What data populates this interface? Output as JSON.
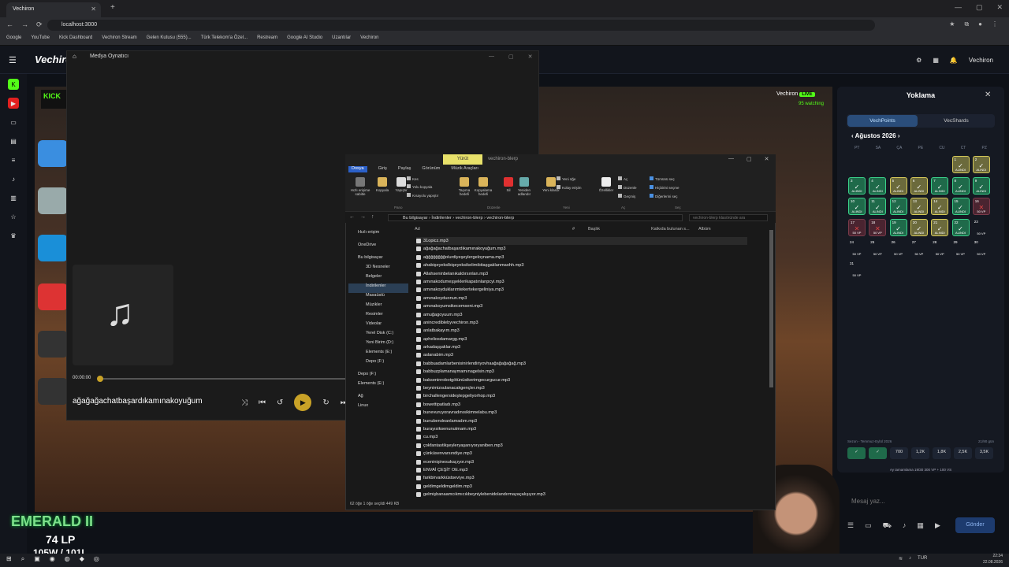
{
  "browser": {
    "tab_title": "Vechiron",
    "url": "localhost:3000",
    "bookmarks": [
      "Google",
      "YouTube",
      "Kick Dashboard",
      "Vechiron Stream",
      "Gelen Kutusu (555)...",
      "Türk Telekom'a Özel...",
      "Restream",
      "Google AI Studio",
      "Uzantılar",
      "Vechiron"
    ]
  },
  "app": {
    "brand": "Vechiron",
    "user": "Vechiron",
    "notif_count": "1"
  },
  "stream": {
    "live_user": "Vechiron",
    "live_label": "LIVE",
    "watching": "95 watching",
    "kick_label": "KICK",
    "rank": "EMERALD II",
    "lp": "74 LP",
    "winloss": "105W / 101L"
  },
  "media_player": {
    "title": "Medya Oynatıcı",
    "time": "00:00:00",
    "song": "ağağağachatbaşardıkamınakoyuğum"
  },
  "explorer": {
    "manage_tab": "Yürüt",
    "window_title": "vechiron-blerp",
    "menus": [
      "Dosya",
      "Giriş",
      "Paylaş",
      "Görünüm",
      "Müzik Araçları"
    ],
    "ribbon": [
      "Hızlı erişime sabitle",
      "Kopyala",
      "Yapıştır",
      "Kes",
      "Yolu kopyala",
      "Kısayolu yapıştır",
      "Taşıma hedefi",
      "Kopyalama hedefi",
      "Sil",
      "Yeniden adlandır",
      "Yeni klasör",
      "Yeni öğe",
      "Kolay erişim",
      "Özellikler",
      "Aç",
      "Düzenle",
      "Geçmiş",
      "Tümünü seç",
      "Hiçbirini seçme",
      "Diğerlerini seç"
    ],
    "ribbon_groups": [
      "Pano",
      "Düzenle",
      "Yeni",
      "Aç",
      "Seç"
    ],
    "path": [
      "Bu bilgisayar",
      "İndirilenler",
      "vechiron-blerp",
      "vechiron-blerp"
    ],
    "search_placeholder": "vechiron-blerp klasöründe ara",
    "columns": [
      "Ad",
      "#",
      "Başlık",
      "Katkıda bulunan s...",
      "Albüm"
    ],
    "sidebar": [
      "Hızlı erişim",
      "OneDrive",
      "Bu bilgisayar",
      "3D Nesneler",
      "Belgeler",
      "İndirilenler",
      "Masaüstü",
      "Müzikler",
      "Resimler",
      "Videolar",
      "Yerel Disk (C:)",
      "Yeni Birim (D:)",
      "Elements (E:)",
      "Depo (F:)",
      "Depo (F:)",
      "Elements (E:)",
      "Ağ",
      "Linux"
    ],
    "files": [
      "31opicz.mp3",
      "ağağağachatbaşardıkamınakoyuğum.mp3",
      "ağğğğğğğğolurdiyeşeylergeloynama.mp3",
      "ahabişeyekslbişeyeksikelimibitaşgaklanmaohh.mp3",
      "Allahseninbelanıkaldırsınlan.mp3",
      "amınakodumeşşeklerikapatınlanpcyi.mp3",
      "amınakoyduklarımtekertekergeliniya.mp3",
      "amınakoyduonun.mp3",
      "amınakoyumsikecemseni.mp3",
      "amuğagoyuum.mp3",
      "anincrediblebyvechiron.mp3",
      "anlatbakayım.mp3",
      "apheliosdamargg.mp3",
      "arkadaşşaklar.mp3",
      "aslanabim.mp3",
      "babbuadamlarbenisinirlendiriyovhaağağağağağ.mp3",
      "babbuzplamanaymamınagelsin.mp3",
      "bakseninrobotgötünüsikerimgecurgucur.mp3",
      "beynimizsulanacakgençler.mp3",
      "birchallengersideştepgeliyorhop.mp3",
      "bowettipatladı.mp3",
      "bunevuruyoravradınısikimnelabu.mp3",
      "bunubendeanlamadım.mp3",
      "burayısiksenunutmam.mp3",
      "cu.mp3",
      "çokfantastikşeyleryaşanıyoryaniben.mp3",
      "çünküsenvarsındiye.mp3",
      "eceninişinesukaçıyor.mp3",
      "ENVAİ ÇEŞİT OE.mp3",
      "farkbirvarkküstseviye.mp3",
      "geldimgeldimgeldim.mp3",
      "gelmişbanaamcıkmıcıkbeyniylebenidolandırmayaçalışıyor.mp3"
    ],
    "status": "62 öğe   1 öğe seçildi  449 KB"
  },
  "attendance": {
    "title": "Yoklama",
    "tab_active": "VechPoints",
    "tab_other": "VecShards",
    "month": "Ağustos 2026",
    "dow": [
      "PT",
      "SA",
      "ÇA",
      "PE",
      "CU",
      "CT",
      "PZ"
    ],
    "claimed": "ALINDI",
    "reward": "50 VP",
    "days": [
      {
        "n": "",
        "s": "e"
      },
      {
        "n": "",
        "s": "e"
      },
      {
        "n": "",
        "s": "e"
      },
      {
        "n": "",
        "s": "e"
      },
      {
        "n": "",
        "s": "e"
      },
      {
        "n": "1",
        "s": "y"
      },
      {
        "n": "2",
        "s": "y"
      },
      {
        "n": "3",
        "s": "g"
      },
      {
        "n": "4",
        "s": "g"
      },
      {
        "n": "5",
        "s": "y"
      },
      {
        "n": "6",
        "s": "y"
      },
      {
        "n": "7",
        "s": "g"
      },
      {
        "n": "8",
        "s": "g"
      },
      {
        "n": "9",
        "s": "g"
      },
      {
        "n": "10",
        "s": "g"
      },
      {
        "n": "11",
        "s": "g"
      },
      {
        "n": "12",
        "s": "g"
      },
      {
        "n": "13",
        "s": "y"
      },
      {
        "n": "14",
        "s": "y"
      },
      {
        "n": "15",
        "s": "g"
      },
      {
        "n": "16",
        "s": "r"
      },
      {
        "n": "17",
        "s": "r"
      },
      {
        "n": "18",
        "s": "r"
      },
      {
        "n": "19",
        "s": "g"
      },
      {
        "n": "20",
        "s": "y"
      },
      {
        "n": "21",
        "s": "y"
      },
      {
        "n": "22",
        "s": "g"
      },
      {
        "n": "23",
        "s": "e"
      },
      {
        "n": "24",
        "s": "e"
      },
      {
        "n": "25",
        "s": "e"
      },
      {
        "n": "26",
        "s": "e"
      },
      {
        "n": "27",
        "s": "e"
      },
      {
        "n": "28",
        "s": "e"
      },
      {
        "n": "29",
        "s": "e"
      },
      {
        "n": "30",
        "s": "e"
      },
      {
        "n": "31",
        "s": "e"
      }
    ],
    "season": "Sezon - Temmuz-Eylül 2026",
    "season_progress": "21/90 gün",
    "stats": [
      "✓",
      "✓",
      "700",
      "1,2K",
      "1,8K",
      "2,5K",
      "3,5K"
    ],
    "foot": "Ay tamamlama 19/30  300 VP + 100 VS",
    "chat_placeholder": "Mesaj yaz...",
    "send": "Gönder"
  },
  "taskbar": {
    "time": "22:34",
    "date": "22.08.2026",
    "lang": "TUR"
  }
}
